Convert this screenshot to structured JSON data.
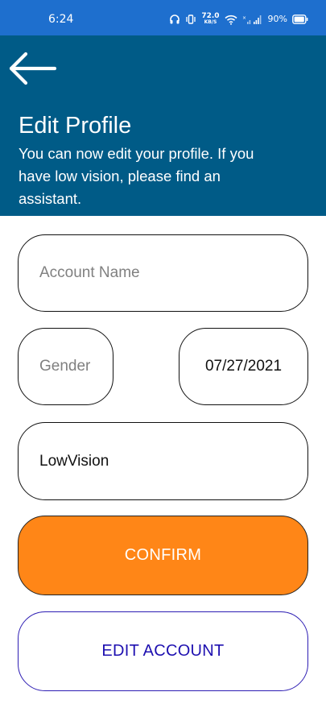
{
  "status_bar": {
    "time": "6:24",
    "net_speed_value": "72.0",
    "net_speed_unit": "KB/S",
    "battery": "90%",
    "icons": [
      "headphones-icon",
      "vibrate-icon",
      "wifi-icon",
      "signal-icon",
      "battery-icon"
    ]
  },
  "header": {
    "back_icon": "arrow-left-icon",
    "title": "Edit Profile",
    "subtitle": "You can now edit your profile. If you have low vision, please find an assistant."
  },
  "form": {
    "account_name": {
      "value": "",
      "placeholder": "Account Name"
    },
    "gender": {
      "value": "",
      "placeholder": "Gender"
    },
    "birth_date": "07/27/2021",
    "disability_type": {
      "value": "LowVision",
      "placeholder": ""
    }
  },
  "buttons": {
    "confirm": "CONFIRM",
    "edit_account": "EDIT ACCOUNT"
  },
  "colors": {
    "status_bar": "#1e6fce",
    "header": "#005b87",
    "confirm_button": "#ff8617",
    "edit_button_text": "#1e10b0"
  }
}
